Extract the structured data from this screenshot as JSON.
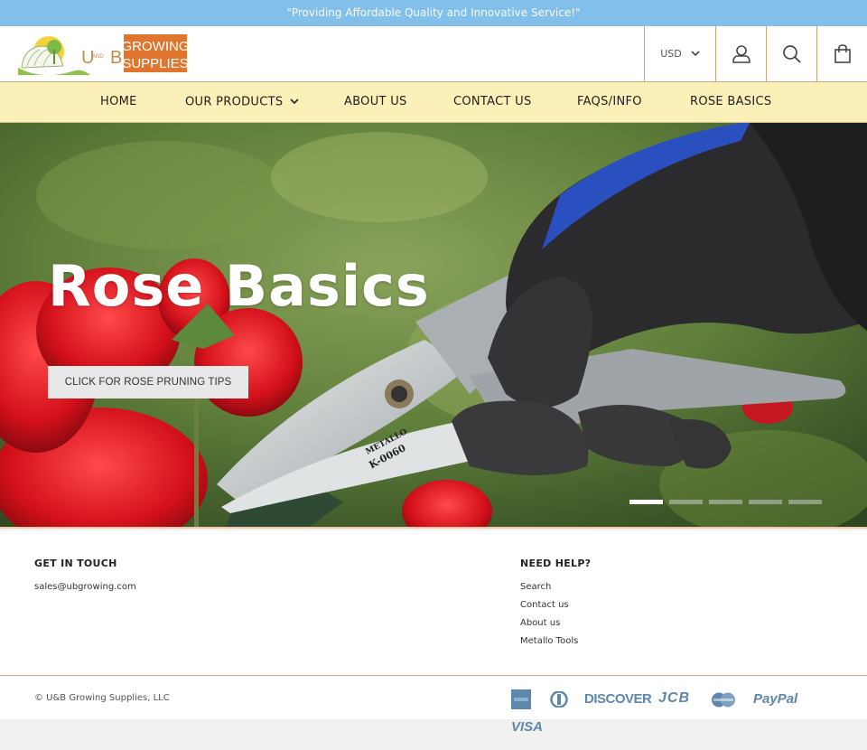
{
  "announcement": "\"Providing Affordable Quality and Innovative Service!\"",
  "brand": {
    "logo_text_1": "U",
    "logo_and": "AND",
    "logo_text_2": "B",
    "logo_growing": "GROWING",
    "logo_supplies": "SUPPLIES"
  },
  "header": {
    "currency": "USD",
    "icons": [
      "user-icon",
      "search-icon",
      "cart-icon"
    ]
  },
  "nav": {
    "items": [
      {
        "label": "HOME"
      },
      {
        "label": "OUR PRODUCTS",
        "has_dropdown": true
      },
      {
        "label": "ABOUT US"
      },
      {
        "label": "CONTACT US"
      },
      {
        "label": "FAQS/INFO"
      },
      {
        "label": "ROSE BASICS"
      }
    ]
  },
  "hero": {
    "title": "Rose Basics",
    "button_label": "CLICK FOR ROSE PRUNING TIPS",
    "tool_brand": "METALLO",
    "tool_model": "K-0060",
    "slides_total": 5,
    "active_slide": 1
  },
  "footer": {
    "get_in_touch": {
      "heading": "GET IN TOUCH",
      "email": "sales@ubgrowing.com"
    },
    "need_help": {
      "heading": "NEED HELP?",
      "links": [
        "Search",
        "Contact us",
        "About us",
        "Metallo Tools"
      ]
    },
    "copyright": "© U&B Growing Supplies, LLC",
    "payments": [
      "American Express",
      "Diners Club",
      "DISCOVER",
      "JCB",
      "Mastercard",
      "PayPal",
      "VISA"
    ]
  },
  "colors": {
    "announcement_bg": "#82c0ea",
    "nav_bg": "#fcf0b9",
    "logo_orange": "#e0762e",
    "border_tan": "#c9a77a",
    "payment_blue": "#5d87ad"
  }
}
